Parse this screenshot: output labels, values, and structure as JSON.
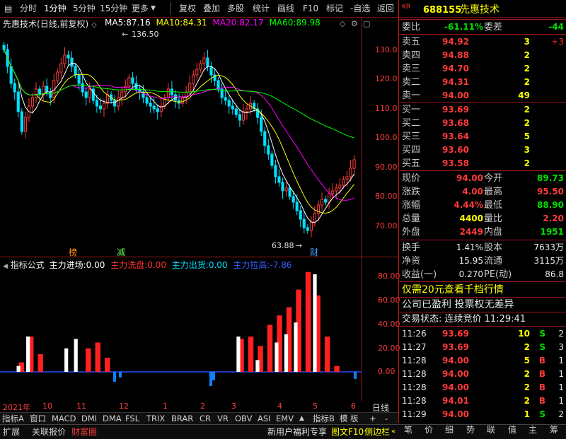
{
  "toolbar": {
    "items": [
      "分时",
      "1分钟",
      "5分钟",
      "15分钟",
      "更多"
    ],
    "active": "1分钟",
    "tools": [
      "复权",
      "叠加",
      "多股",
      "统计",
      "画线",
      "F10",
      "标记",
      "-自选",
      "返回"
    ]
  },
  "main_chart": {
    "title": "先惠技术",
    "period_note": "(日线,前复权)",
    "ma": [
      {
        "label": "MA5:",
        "value": "87.16",
        "color": "#ffffff"
      },
      {
        "label": "MA10:",
        "value": "84.31",
        "color": "#ffff00"
      },
      {
        "label": "MA20:",
        "value": "82.17",
        "color": "#ff00ff"
      },
      {
        "label": "MA60:",
        "value": "89.98",
        "color": "#00ff00"
      }
    ],
    "high_mark": "136.50",
    "low_mark": "63.88",
    "badges": [
      {
        "text": "榜",
        "color": "#ff8c1a"
      },
      {
        "text": "减",
        "color": "#60ff60"
      },
      {
        "text": "财",
        "color": "#40a0ff"
      }
    ],
    "y_ticks": [
      "130.0",
      "120.0",
      "110.0",
      "100.0",
      "90.00",
      "80.00",
      "70.00"
    ]
  },
  "indicator": {
    "name": "指标公式",
    "items": [
      {
        "label": "主力进场:",
        "value": "0.00",
        "color": "#ffffff"
      },
      {
        "label": "主力洗盘:",
        "value": "0.00",
        "color": "#ff3030"
      },
      {
        "label": "主力出货:",
        "value": "0.00",
        "color": "#00e0ff"
      },
      {
        "label": "主力拉高:",
        "value": "-7.86",
        "color": "#3060ff"
      }
    ],
    "y_ticks": [
      "80.00",
      "60.00",
      "40.00",
      "20.00",
      "0.00"
    ]
  },
  "x_axis": [
    "2021年",
    "10",
    "11",
    "12",
    "1",
    "2",
    "3",
    "4",
    "5",
    "6"
  ],
  "x_axis_right": "日线",
  "tabs": [
    "指标A",
    "窗口",
    "MACD",
    "DMI",
    "DMA",
    "FSL",
    "TRIX",
    "BRAR",
    "CR",
    "VR",
    "OBV",
    "ASI",
    "EMV"
  ],
  "tabs_right": [
    "指标B",
    "模 板",
    "+",
    "-"
  ],
  "status": {
    "left": [
      "扩展",
      "关联报价",
      "财富圈"
    ],
    "right": [
      "新用户福利专享",
      "图文F10",
      "侧边栏"
    ]
  },
  "panel": {
    "badge": "KR",
    "code": "688155",
    "name": "先惠技术",
    "weibi_label": "委比",
    "weibi": "-61.11%",
    "weicha_label": "委差",
    "weicha": "-44",
    "asks": [
      {
        "label": "卖五",
        "price": "94.92",
        "vol": "3",
        "chg": "+3"
      },
      {
        "label": "卖四",
        "price": "94.88",
        "vol": "2",
        "chg": ""
      },
      {
        "label": "卖三",
        "price": "94.70",
        "vol": "2",
        "chg": ""
      },
      {
        "label": "卖二",
        "price": "94.31",
        "vol": "2",
        "chg": ""
      },
      {
        "label": "卖一",
        "price": "94.00",
        "vol": "49",
        "chg": ""
      }
    ],
    "bids": [
      {
        "label": "买一",
        "price": "93.69",
        "vol": "2"
      },
      {
        "label": "买二",
        "price": "93.68",
        "vol": "2"
      },
      {
        "label": "买三",
        "price": "93.64",
        "vol": "5"
      },
      {
        "label": "买四",
        "price": "93.60",
        "vol": "3"
      },
      {
        "label": "买五",
        "price": "93.58",
        "vol": "2"
      }
    ],
    "stats": [
      {
        "l1": "现价",
        "v1": "94.00",
        "c1": "#ff3b3b",
        "l2": "今开",
        "v2": "89.73",
        "c2": "#00e000"
      },
      {
        "l1": "涨跌",
        "v1": "4.00",
        "c1": "#ff3b3b",
        "l2": "最高",
        "v2": "95.50",
        "c2": "#ff3b3b"
      },
      {
        "l1": "涨幅",
        "v1": "4.44%",
        "c1": "#ff3b3b",
        "l2": "最低",
        "v2": "88.90",
        "c2": "#00e000"
      },
      {
        "l1": "总量",
        "v1": "4400",
        "c1": "#ffff00",
        "l2": "量比",
        "v2": "2.20",
        "c2": "#ff3b3b"
      },
      {
        "l1": "外盘",
        "v1": "2449",
        "c1": "#ff3b3b",
        "l2": "内盘",
        "v2": "1951",
        "c2": "#00e000"
      }
    ],
    "stats2": [
      {
        "l1": "换手",
        "v1": "1.41%",
        "l2": "股本",
        "v2": "7633万"
      },
      {
        "l1": "净资",
        "v1": "15.95",
        "l2": "流通",
        "v2": "3115万"
      },
      {
        "l1": "收益(一)",
        "v1": "0.270",
        "l2": "PE(动)",
        "v2": "86.8"
      }
    ],
    "promo": "仅需20元查看千档行情",
    "notice": "公司已盈利 投票权无差异",
    "trade_state": "交易状态: 连续竞价 11:29:41",
    "ticks": [
      {
        "time": "11:26",
        "price": "93.69",
        "vol": "10",
        "side": "S"
      },
      {
        "time": "11:27",
        "price": "93.69",
        "vol": "2",
        "side": "S"
      },
      {
        "time": "11:28",
        "price": "94.00",
        "vol": "5",
        "side": "B"
      },
      {
        "time": "11:28",
        "price": "94.00",
        "vol": "2",
        "side": "B"
      },
      {
        "time": "11:28",
        "price": "94.00",
        "vol": "2",
        "side": "B"
      },
      {
        "time": "11:28",
        "price": "94.01",
        "vol": "2",
        "side": "B"
      },
      {
        "time": "11:29",
        "price": "94.00",
        "vol": "1",
        "side": "S"
      }
    ],
    "tick_counts": [
      "2",
      "3",
      "1",
      "1",
      "1",
      "1",
      "2"
    ]
  },
  "right_tabs": [
    "笔",
    "价",
    "细",
    "势",
    "联",
    "值",
    "主",
    "筹"
  ],
  "chart_data": {
    "type": "candlestick",
    "title": "先惠技术",
    "ylim": [
      62,
      142
    ],
    "closes": [
      133,
      127,
      121,
      118,
      111,
      104,
      109,
      113,
      116,
      119,
      117,
      120,
      118,
      116,
      122,
      125,
      128,
      131,
      130,
      127,
      124,
      121,
      118,
      116,
      119,
      115,
      113,
      112,
      114,
      117,
      115,
      113,
      116,
      118,
      120,
      123,
      121,
      119,
      118,
      116,
      114,
      113,
      112,
      111,
      113,
      116,
      119,
      117,
      115,
      114,
      116,
      118,
      121,
      124,
      126,
      128,
      130,
      127,
      124,
      122,
      119,
      116,
      115,
      113,
      112,
      110,
      108,
      111,
      112,
      114,
      112,
      109,
      104,
      99,
      96,
      92,
      88,
      86,
      83,
      84,
      81,
      79,
      76,
      73,
      70,
      69,
      72,
      75,
      78,
      80,
      79,
      82,
      83,
      84,
      85,
      87,
      88,
      91,
      94
    ],
    "ind_red": [
      0,
      8,
      30,
      15,
      0,
      0,
      0,
      0,
      20,
      25,
      12,
      0,
      0,
      0,
      0,
      0,
      0,
      0,
      0,
      0,
      0,
      0,
      0,
      0,
      28,
      30,
      22,
      40,
      48,
      55,
      70,
      85,
      65,
      30,
      5,
      0,
      0
    ],
    "ind_white": [
      0,
      5,
      30,
      0,
      0,
      0,
      20,
      28,
      0,
      0,
      0,
      0,
      0,
      0,
      0,
      0,
      0,
      0,
      0,
      0,
      0,
      0,
      0,
      0,
      30,
      0,
      10,
      0,
      25,
      32,
      42,
      0,
      83,
      0,
      0,
      0,
      0
    ]
  }
}
